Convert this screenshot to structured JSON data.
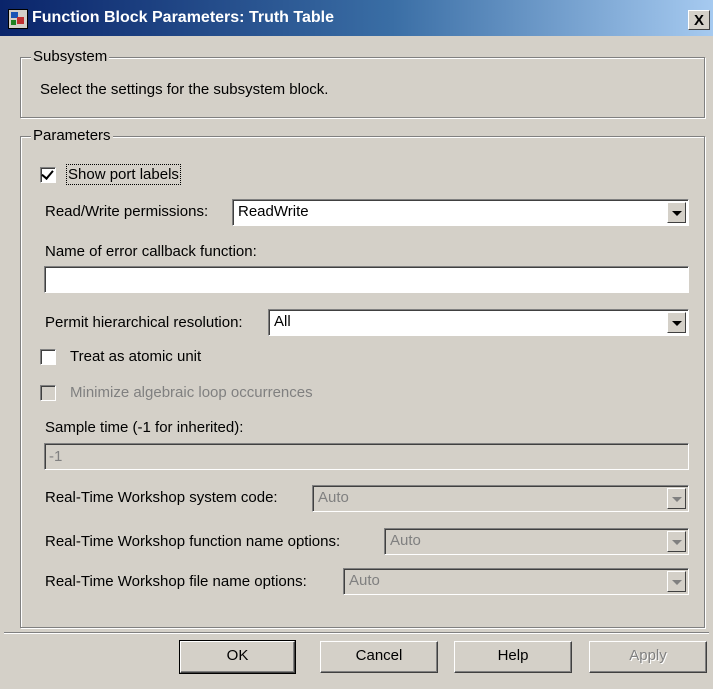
{
  "window": {
    "title": "Function Block Parameters: Truth Table",
    "close_glyph": "X",
    "icon": "simulink-block-icon"
  },
  "subsystem": {
    "legend": "Subsystem",
    "description": "Select the settings for the subsystem block."
  },
  "parameters": {
    "legend": "Parameters",
    "show_port_labels": {
      "label": "Show port labels",
      "checked": true
    },
    "rw_permissions": {
      "label": "Read/Write permissions:",
      "value": "ReadWrite"
    },
    "error_callback": {
      "label": "Name of error callback function:",
      "value": ""
    },
    "hierarchical_resolution": {
      "label": "Permit hierarchical resolution:",
      "value": "All"
    },
    "atomic_unit": {
      "label": "Treat as atomic unit",
      "checked": false
    },
    "minimize_loop": {
      "label": "Minimize algebraic loop occurrences",
      "checked": false,
      "enabled": false
    },
    "sample_time": {
      "label": "Sample time (-1 for inherited):",
      "value": "-1",
      "enabled": false
    },
    "rtw_system_code": {
      "label": "Real-Time Workshop system code:",
      "value": "Auto",
      "enabled": false
    },
    "rtw_function_name": {
      "label": "Real-Time Workshop function name options:",
      "value": "Auto",
      "enabled": false
    },
    "rtw_file_name": {
      "label": "Real-Time Workshop file name options:",
      "value": "Auto",
      "enabled": false
    }
  },
  "buttons": {
    "ok": "OK",
    "cancel": "Cancel",
    "help": "Help",
    "apply": "Apply"
  },
  "colors": {
    "face": "#d4d0c8",
    "title_start": "#0a246a",
    "title_end": "#a6caf0",
    "disabled_text": "#808080"
  }
}
